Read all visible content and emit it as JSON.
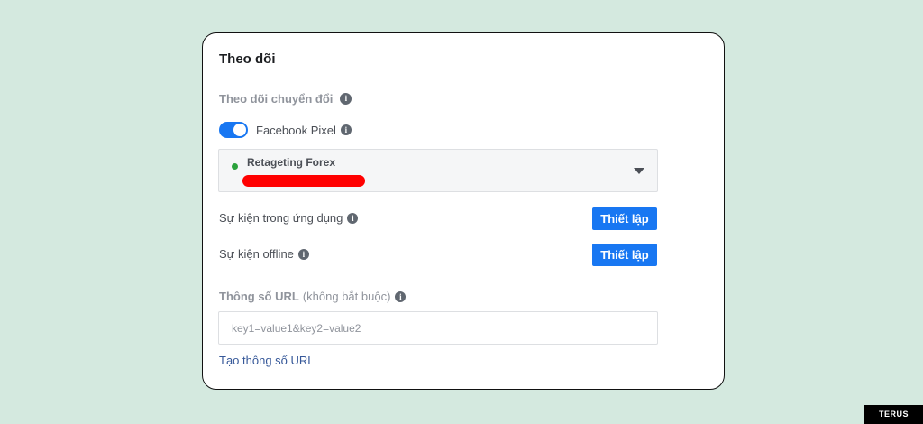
{
  "section": {
    "title": "Theo dõi"
  },
  "conversion": {
    "heading": "Theo dõi chuyển đổi",
    "pixel_toggle_label": "Facebook Pixel",
    "pixel_enabled": true,
    "selected_pixel": "Retageting Forex",
    "pixel_status_color": "#2ba23c"
  },
  "app_events": {
    "label": "Sự kiện trong ứng dụng",
    "button_label": "Thiết lập"
  },
  "offline_events": {
    "label": "Sự kiện offline",
    "button_label": "Thiết lập"
  },
  "url_params": {
    "label": "Thông số URL",
    "optional": "(không bắt buộc)",
    "placeholder": "key1=value1&key2=value2",
    "value": "",
    "builder_link": "Tạo thông số URL"
  },
  "icons": {
    "info": "i"
  },
  "watermark": {
    "text": "TERUS"
  },
  "colors": {
    "accent": "#1877f2",
    "background": "#d4e9df",
    "link": "#365899",
    "redaction": "#ff0000"
  }
}
